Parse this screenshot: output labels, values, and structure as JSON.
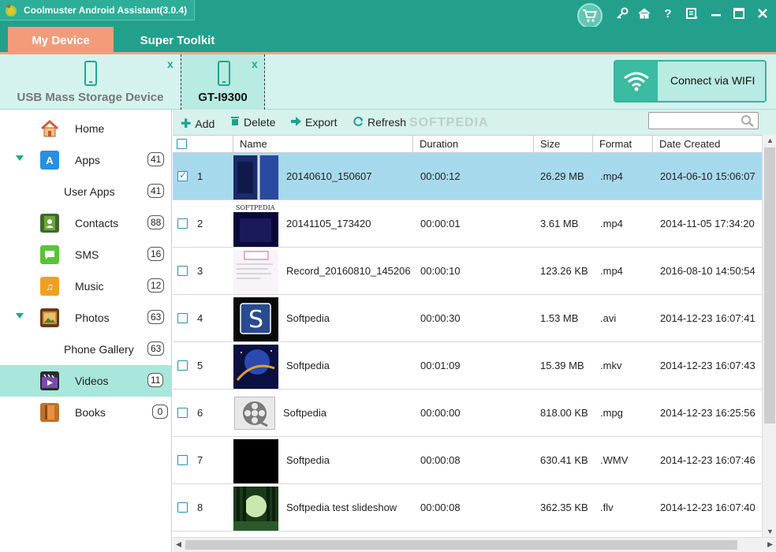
{
  "window": {
    "title": "Coolmuster Android Assistant(3.0.4)"
  },
  "titlebar_icons": [
    "cart-icon",
    "key-icon",
    "home-icon",
    "help-icon",
    "feedback-icon",
    "minimize-icon",
    "maximize-icon",
    "close-icon"
  ],
  "tabs": [
    {
      "label": "My Device",
      "active": true
    },
    {
      "label": "Super Toolkit",
      "active": false
    }
  ],
  "devices": [
    {
      "label": "USB Mass Storage Device",
      "close": "x",
      "active": false
    },
    {
      "label": "GT-I9300",
      "close": "x",
      "active": true
    }
  ],
  "wifi": {
    "label": "Connect via WIFI"
  },
  "sidebar": {
    "items": [
      {
        "label": "Home",
        "icon": "home-icon",
        "color": "#e05a3a"
      },
      {
        "label": "Apps",
        "count": "41",
        "icon": "apps-icon",
        "color": "#2a8fe0",
        "expanded": true
      },
      {
        "label": "User Apps",
        "count": "41",
        "sub": true
      },
      {
        "label": "Contacts",
        "count": "88",
        "icon": "contacts-icon",
        "color": "#3f7a3a"
      },
      {
        "label": "SMS",
        "count": "16",
        "icon": "sms-icon",
        "color": "#59c23a"
      },
      {
        "label": "Music",
        "count": "12",
        "icon": "music-icon",
        "color": "#f0a020"
      },
      {
        "label": "Photos",
        "count": "63",
        "icon": "photos-icon",
        "color": "#8a5a2a",
        "expanded": true
      },
      {
        "label": "Phone Gallery",
        "count": "63",
        "sub": true
      },
      {
        "label": "Videos",
        "count": "11",
        "icon": "videos-icon",
        "color": "#6a3aa0",
        "active": true
      },
      {
        "label": "Books",
        "count": "0",
        "icon": "books-icon",
        "color": "#c0702a"
      }
    ]
  },
  "toolbar": {
    "add": "Add",
    "delete": "Delete",
    "export": "Export",
    "refresh": "Refresh",
    "search_placeholder": ""
  },
  "watermark": "SOFTPEDIA",
  "table": {
    "columns": [
      "Name",
      "Duration",
      "Size",
      "Format",
      "Date Created"
    ],
    "rows": [
      {
        "num": "1",
        "name": "20140610_150607",
        "duration": "00:00:12",
        "size": "26.29 MB",
        "format": ".mp4",
        "date": "2014-06-10 15:06:07",
        "checked": true,
        "selected": true,
        "thumb": "blue"
      },
      {
        "num": "2",
        "name": "20141105_173420",
        "duration": "00:00:01",
        "size": "3.61 MB",
        "format": ".mp4",
        "date": "2014-11-05 17:34:20",
        "checked": false,
        "thumb": "softpedia"
      },
      {
        "num": "3",
        "name": "Record_20160810_145206",
        "duration": "00:00:10",
        "size": "123.26 KB",
        "format": ".mp4",
        "date": "2016-08-10 14:50:54",
        "checked": false,
        "thumb": "screen"
      },
      {
        "num": "4",
        "name": "Softpedia",
        "duration": "00:00:30",
        "size": "1.53 MB",
        "format": ".avi",
        "date": "2014-12-23 16:07:41",
        "checked": false,
        "thumb": "s-logo"
      },
      {
        "num": "5",
        "name": "Softpedia",
        "duration": "00:01:09",
        "size": "15.39 MB",
        "format": ".mkv",
        "date": "2014-12-23 16:07:43",
        "checked": false,
        "thumb": "space"
      },
      {
        "num": "6",
        "name": "Softpedia",
        "duration": "00:00:00",
        "size": "818.00 KB",
        "format": ".mpg",
        "date": "2014-12-23 16:25:56",
        "checked": false,
        "thumb": "reel"
      },
      {
        "num": "7",
        "name": "Softpedia",
        "duration": "00:00:08",
        "size": "630.41 KB",
        "format": ".WMV",
        "date": "2014-12-23 16:07:46",
        "checked": false,
        "thumb": "black"
      },
      {
        "num": "8",
        "name": "Softpedia test slideshow",
        "duration": "00:00:08",
        "size": "362.35 KB",
        "format": ".flv",
        "date": "2014-12-23 16:07:40",
        "checked": false,
        "thumb": "forest"
      }
    ]
  }
}
